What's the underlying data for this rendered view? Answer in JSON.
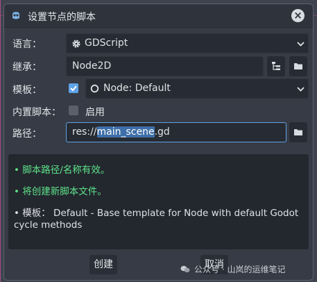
{
  "window": {
    "title": "设置节点的脚本",
    "close_icon": "×"
  },
  "form": {
    "language": {
      "label": "语言：",
      "value": "GDScript",
      "icon": "gear-icon"
    },
    "inherits": {
      "label": "继承：",
      "value": "Node2D"
    },
    "template": {
      "label": "模板：",
      "checked": true,
      "value": "Node: Default",
      "icon": "node-circle-icon"
    },
    "builtin": {
      "label": "内置脚本：",
      "checked": false,
      "option_label": "启用"
    },
    "path": {
      "label": "路径：",
      "value_prefix": "res://",
      "value_selected": "main_scene",
      "value_suffix": ".gd"
    }
  },
  "info": {
    "lines": [
      {
        "bullet": "•",
        "text": "脚本路径/名称有效。"
      },
      {
        "bullet": "•",
        "text": "将创建新脚本文件。"
      },
      {
        "bullet": "•",
        "text": "模板：  Default - Base template for Node with default Godot",
        "continuation": "cycle methods"
      }
    ]
  },
  "buttons": {
    "create": "创建",
    "cancel": "取消"
  },
  "watermark": {
    "text": "公众号 · 山岚的运维笔记"
  },
  "colors": {
    "valid_text": "#5ee38a",
    "accent": "#5fa3e8",
    "selection": "#3e6fa8"
  }
}
